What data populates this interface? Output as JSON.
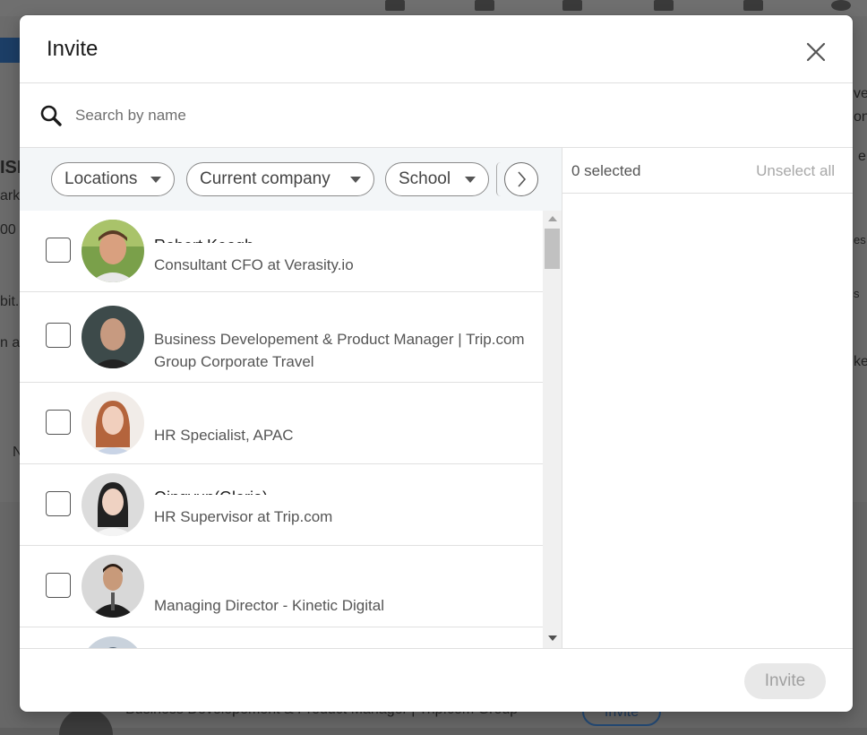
{
  "background": {
    "text_fragments": [
      "ISI",
      "ark",
      "00",
      "bit.l",
      "n ar",
      "N"
    ],
    "right_fragments": [
      "ve",
      "on",
      "e",
      "es",
      "s",
      "ke"
    ],
    "bottom_text": "Business Developement & Product Manager | Trip.com Group",
    "bottom_button": "Invite"
  },
  "modal": {
    "title": "Invite",
    "search": {
      "placeholder": "Search by name"
    },
    "filters": [
      "Locations",
      "Current company",
      "School"
    ],
    "contacts": [
      {
        "name": "Robert Keogh",
        "headline": "Consultant CFO at Verasity.io",
        "avatar": "avatar-robert"
      },
      {
        "name": "",
        "headline": "Business Developement & Product Manager | Trip.com Group Corporate Travel",
        "avatar": "avatar-man-bald"
      },
      {
        "name": "",
        "headline": "HR Specialist, APAC",
        "avatar": "avatar-woman-redhair"
      },
      {
        "name": "Qingyun(Gloria)",
        "headline": "HR Supervisor at Trip.com",
        "avatar": "avatar-woman-dark"
      },
      {
        "name": "",
        "headline": "Managing Director - Kinetic Digital",
        "avatar": "avatar-man-suit"
      }
    ],
    "selected_label": "0 selected",
    "unselect_all_label": "Unselect all",
    "invite_label": "Invite",
    "colors": {
      "accent_disabled": "#e8e8e8",
      "filter_bg": "#f3f6f8"
    }
  }
}
